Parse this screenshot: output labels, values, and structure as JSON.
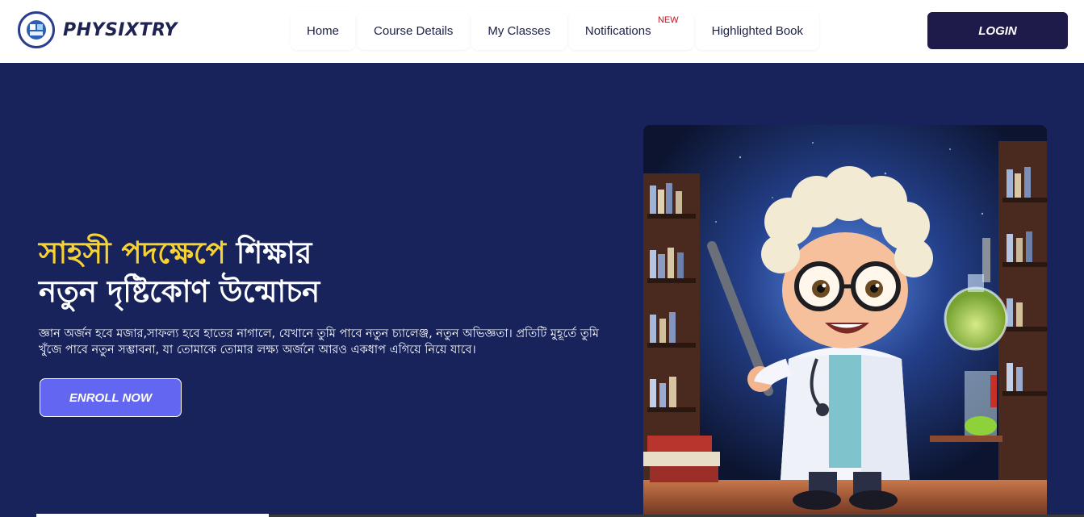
{
  "header": {
    "brand": "PHYSIXTRY",
    "nav": [
      {
        "label": "Home"
      },
      {
        "label": "Course Details"
      },
      {
        "label": "My Classes"
      },
      {
        "label": "Notifications",
        "badge": "NEW"
      },
      {
        "label": "Highlighted Book"
      }
    ],
    "login_label": "LOGIN"
  },
  "hero": {
    "title_highlight": "সাহসী পদক্ষেপে",
    "title_rest": " শিক্ষার",
    "title_line2": "নতুন দৃষ্টিকোণ উন্মোচন",
    "description": "জ্ঞান অর্জন হবে মজার,সাফল্য হবে হাতের নাগালে, যেখানে তুমি পাবে নতুন চ্যালেঞ্জ, নতুন অভিজ্ঞতা। প্রতিটি মুহূর্তে তুমি খুঁজে পাবে নতুন সম্ভাবনা, যা তোমাকে তোমার লক্ষ্য অর্জনে আরও একধাপ এগিয়ে নিয়ে যাবে।",
    "enroll_label": "ENROLL NOW"
  },
  "colors": {
    "hero_bg": "#17235a",
    "accent_yellow": "#f7d233",
    "button_purple": "#6366f1",
    "login_bg": "#1e1b4b"
  }
}
